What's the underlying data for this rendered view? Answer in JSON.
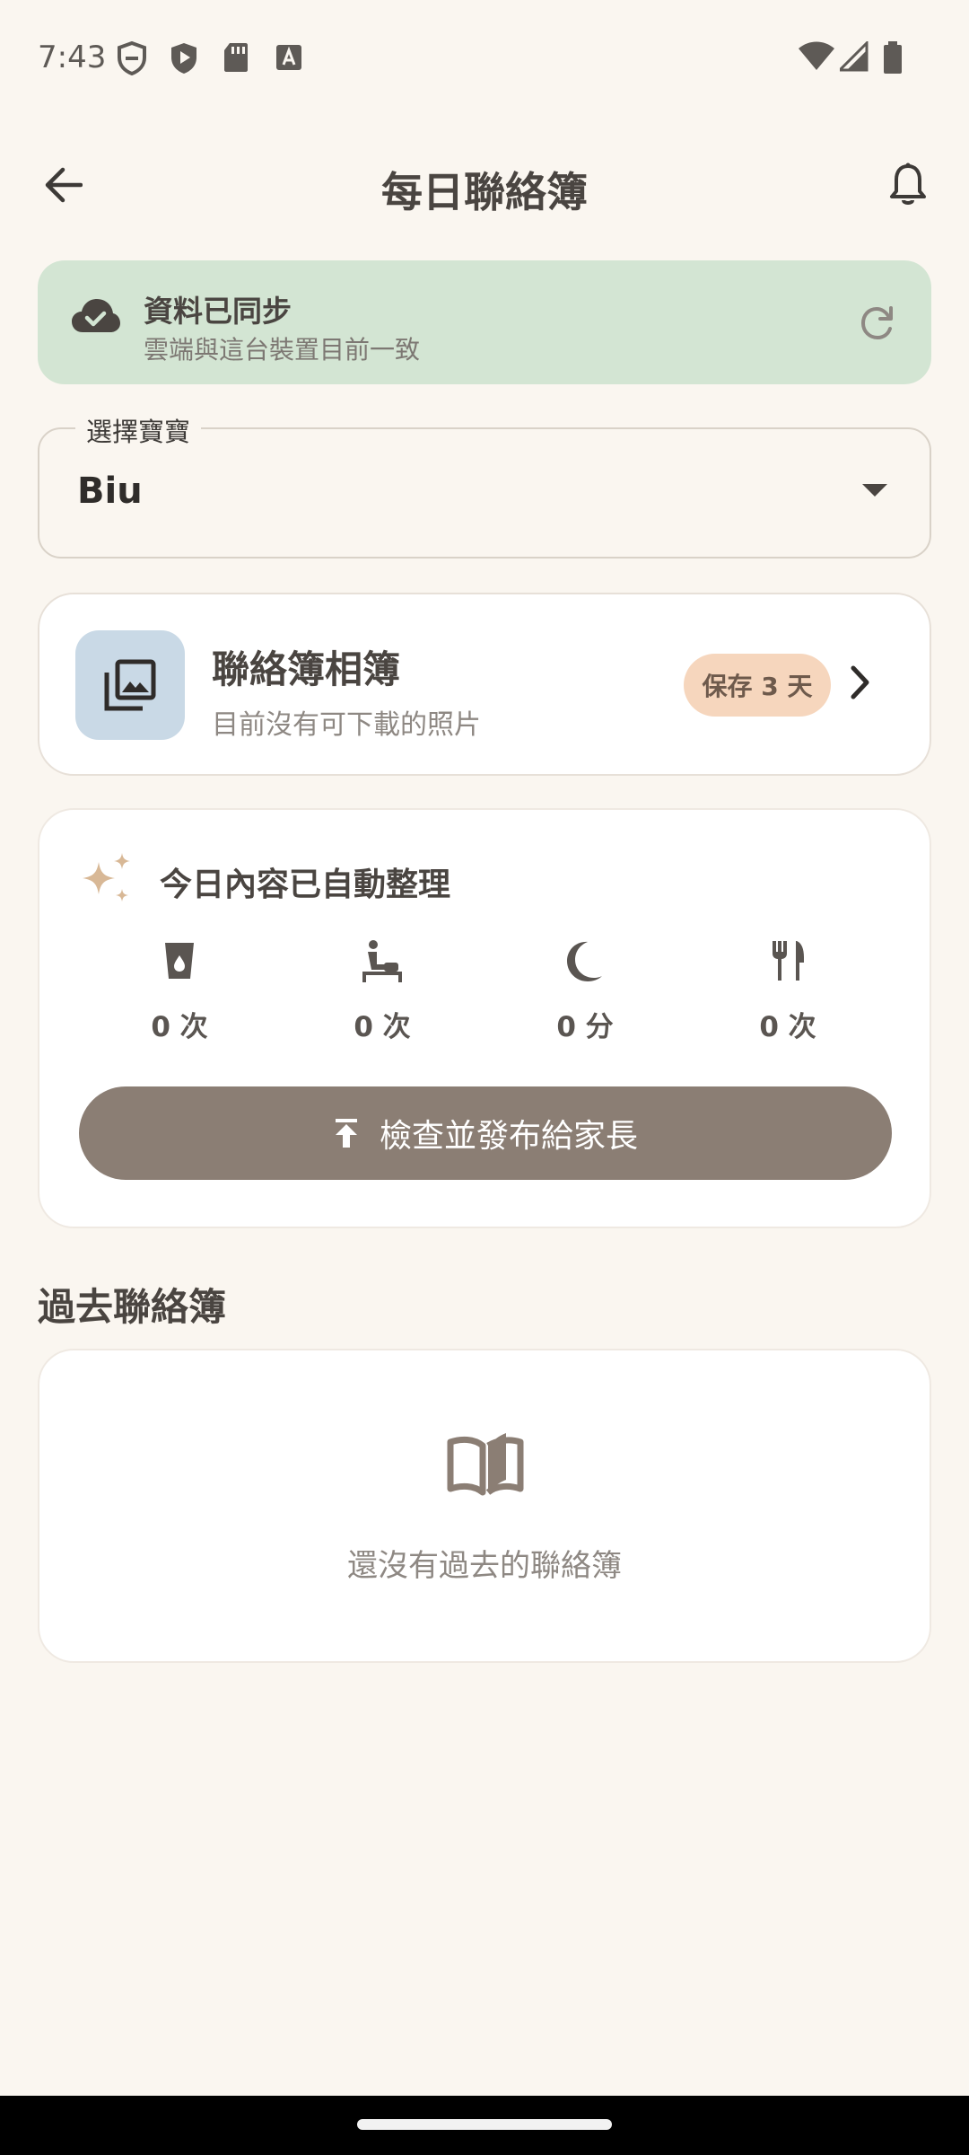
{
  "status_bar": {
    "time": "7:43",
    "left_icons": [
      "privacy-shield-icon",
      "play-protect-icon",
      "sd-card-icon",
      "keyboard-a-icon"
    ],
    "right_icons": [
      "wifi-icon",
      "cellular-signal-icon",
      "battery-icon"
    ]
  },
  "header": {
    "title": "每日聯絡簿",
    "back_icon": "arrow-back-icon",
    "notification_icon": "bell-icon"
  },
  "sync": {
    "title": "資料已同步",
    "subtitle": "雲端與這台裝置目前一致",
    "icon": "cloud-check-icon",
    "refresh_icon": "refresh-icon"
  },
  "baby_select": {
    "label": "選擇寶寶",
    "value": "Biu"
  },
  "album": {
    "title": "聯絡簿相簿",
    "subtitle": "目前沒有可下載的照片",
    "badge": "保存 3 天",
    "icon": "photo-library-icon"
  },
  "summary": {
    "title": "今日內容已自動整理",
    "stats": [
      {
        "icon": "drink-cup-icon",
        "value": "0 次"
      },
      {
        "icon": "diaper-change-icon",
        "value": "0 次"
      },
      {
        "icon": "moon-sleep-icon",
        "value": "0 分"
      },
      {
        "icon": "fork-knife-icon",
        "value": "0 次"
      }
    ],
    "publish_label": "檢查並發布給家長"
  },
  "past": {
    "heading": "過去聯絡簿",
    "empty_text": "還沒有過去的聯絡簿"
  },
  "colors": {
    "background": "#FAF6F0",
    "sync_bg": "#D3E5D3",
    "album_thumb_bg": "#C9D9E6",
    "badge_bg": "#F6D6BD",
    "primary_button": "#8B7E74",
    "sparkle": "#D8B896"
  }
}
